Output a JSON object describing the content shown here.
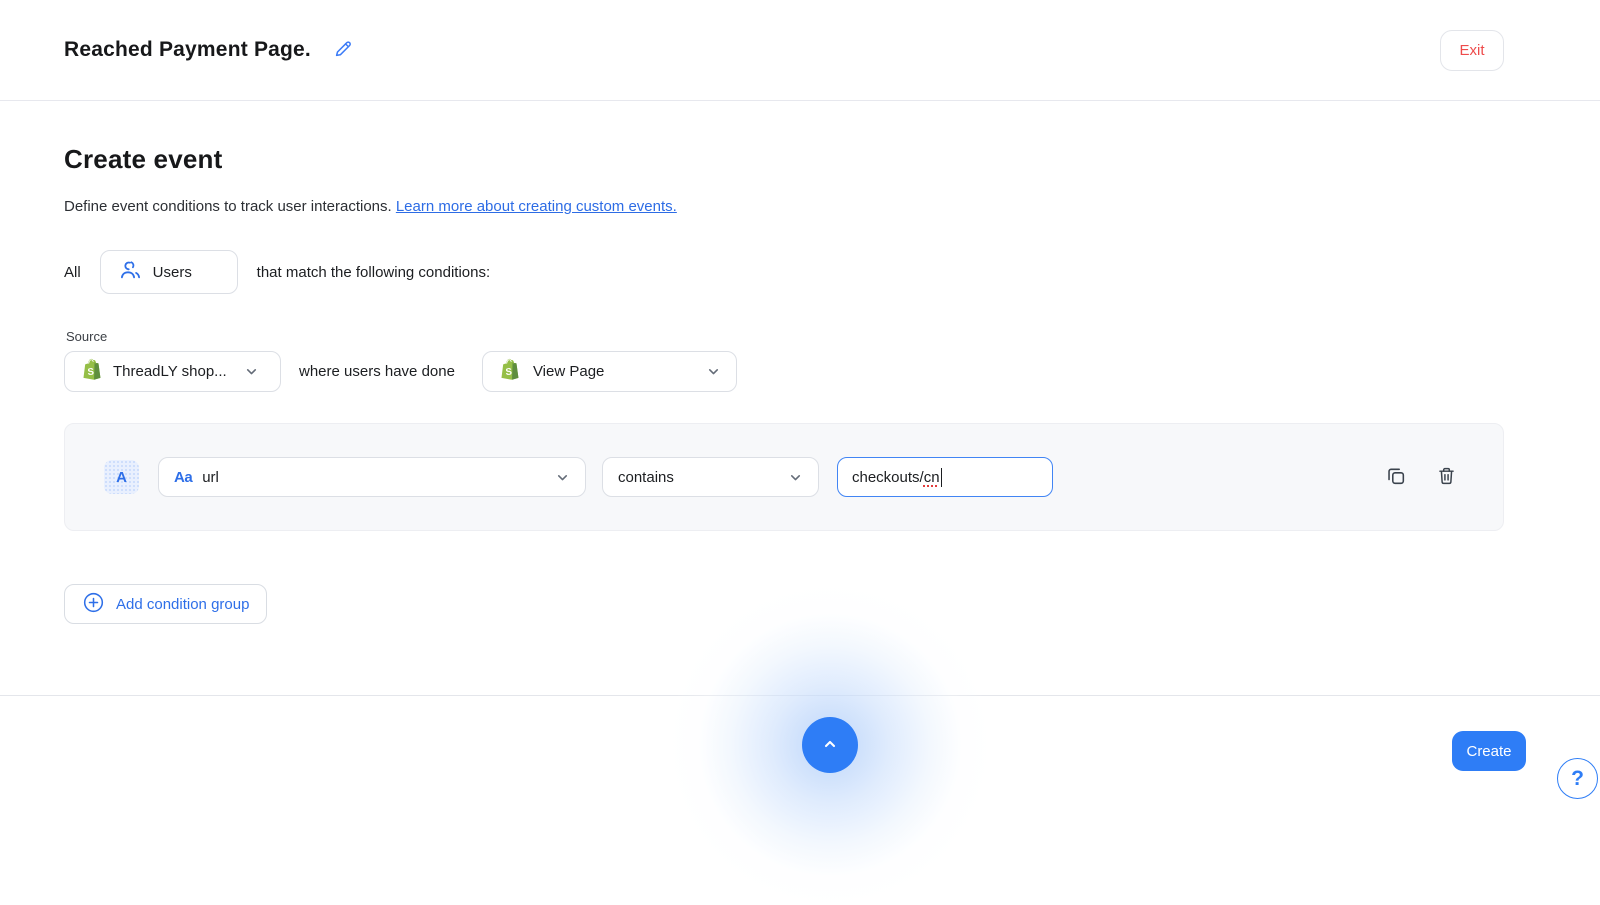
{
  "colors": {
    "accent_blue": "#2e7df6",
    "link_blue": "#2d6ce5",
    "exit_red": "#ee4b4b",
    "shopify_green": "#95BF47",
    "shopify_green_dark": "#5E8E3E",
    "condition_box_bg": "#f7f8fa",
    "focus_border": "#4285f4",
    "spellcheck_red": "#e23c3c"
  },
  "header": {
    "title": "Reached Payment Page.",
    "exit_label": "Exit"
  },
  "main": {
    "heading": "Create event",
    "description_text": "Define event conditions to track user interactions. ",
    "learn_more_link": "Learn more about creating custom events.",
    "audience": {
      "prefix": "All",
      "selector_label": "Users",
      "suffix": "that match the following conditions:"
    },
    "source": {
      "label": "Source",
      "source_dropdown_value": "ThreadLY shop...",
      "connector_text": "where users have done",
      "event_dropdown_value": "View Page"
    },
    "condition_group": {
      "badge": "A",
      "field_type_icon": "Aa",
      "field_value": "url",
      "operator_value": "contains",
      "value_typed": "checkouts/",
      "value_flagged": "cn",
      "value_full": "checkouts/cn"
    },
    "add_condition_group_label": "Add condition group"
  },
  "footer": {
    "create_label": "Create",
    "help_label": "?"
  }
}
